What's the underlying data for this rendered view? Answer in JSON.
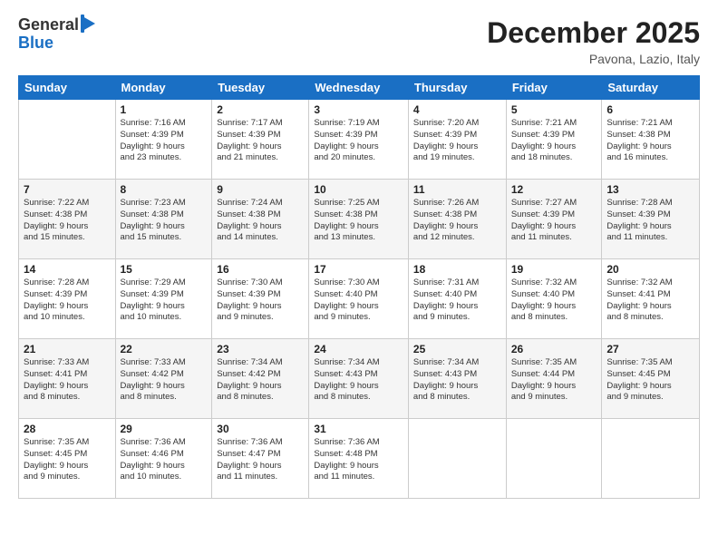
{
  "header": {
    "logo_general": "General",
    "logo_blue": "Blue",
    "title": "December 2025",
    "location": "Pavona, Lazio, Italy"
  },
  "days_of_week": [
    "Sunday",
    "Monday",
    "Tuesday",
    "Wednesday",
    "Thursday",
    "Friday",
    "Saturday"
  ],
  "weeks": [
    [
      {
        "day": "",
        "info": ""
      },
      {
        "day": "1",
        "info": "Sunrise: 7:16 AM\nSunset: 4:39 PM\nDaylight: 9 hours\nand 23 minutes."
      },
      {
        "day": "2",
        "info": "Sunrise: 7:17 AM\nSunset: 4:39 PM\nDaylight: 9 hours\nand 21 minutes."
      },
      {
        "day": "3",
        "info": "Sunrise: 7:19 AM\nSunset: 4:39 PM\nDaylight: 9 hours\nand 20 minutes."
      },
      {
        "day": "4",
        "info": "Sunrise: 7:20 AM\nSunset: 4:39 PM\nDaylight: 9 hours\nand 19 minutes."
      },
      {
        "day": "5",
        "info": "Sunrise: 7:21 AM\nSunset: 4:39 PM\nDaylight: 9 hours\nand 18 minutes."
      },
      {
        "day": "6",
        "info": "Sunrise: 7:21 AM\nSunset: 4:38 PM\nDaylight: 9 hours\nand 16 minutes."
      }
    ],
    [
      {
        "day": "7",
        "info": "Sunrise: 7:22 AM\nSunset: 4:38 PM\nDaylight: 9 hours\nand 15 minutes."
      },
      {
        "day": "8",
        "info": "Sunrise: 7:23 AM\nSunset: 4:38 PM\nDaylight: 9 hours\nand 15 minutes."
      },
      {
        "day": "9",
        "info": "Sunrise: 7:24 AM\nSunset: 4:38 PM\nDaylight: 9 hours\nand 14 minutes."
      },
      {
        "day": "10",
        "info": "Sunrise: 7:25 AM\nSunset: 4:38 PM\nDaylight: 9 hours\nand 13 minutes."
      },
      {
        "day": "11",
        "info": "Sunrise: 7:26 AM\nSunset: 4:38 PM\nDaylight: 9 hours\nand 12 minutes."
      },
      {
        "day": "12",
        "info": "Sunrise: 7:27 AM\nSunset: 4:39 PM\nDaylight: 9 hours\nand 11 minutes."
      },
      {
        "day": "13",
        "info": "Sunrise: 7:28 AM\nSunset: 4:39 PM\nDaylight: 9 hours\nand 11 minutes."
      }
    ],
    [
      {
        "day": "14",
        "info": "Sunrise: 7:28 AM\nSunset: 4:39 PM\nDaylight: 9 hours\nand 10 minutes."
      },
      {
        "day": "15",
        "info": "Sunrise: 7:29 AM\nSunset: 4:39 PM\nDaylight: 9 hours\nand 10 minutes."
      },
      {
        "day": "16",
        "info": "Sunrise: 7:30 AM\nSunset: 4:39 PM\nDaylight: 9 hours\nand 9 minutes."
      },
      {
        "day": "17",
        "info": "Sunrise: 7:30 AM\nSunset: 4:40 PM\nDaylight: 9 hours\nand 9 minutes."
      },
      {
        "day": "18",
        "info": "Sunrise: 7:31 AM\nSunset: 4:40 PM\nDaylight: 9 hours\nand 9 minutes."
      },
      {
        "day": "19",
        "info": "Sunrise: 7:32 AM\nSunset: 4:40 PM\nDaylight: 9 hours\nand 8 minutes."
      },
      {
        "day": "20",
        "info": "Sunrise: 7:32 AM\nSunset: 4:41 PM\nDaylight: 9 hours\nand 8 minutes."
      }
    ],
    [
      {
        "day": "21",
        "info": "Sunrise: 7:33 AM\nSunset: 4:41 PM\nDaylight: 9 hours\nand 8 minutes."
      },
      {
        "day": "22",
        "info": "Sunrise: 7:33 AM\nSunset: 4:42 PM\nDaylight: 9 hours\nand 8 minutes."
      },
      {
        "day": "23",
        "info": "Sunrise: 7:34 AM\nSunset: 4:42 PM\nDaylight: 9 hours\nand 8 minutes."
      },
      {
        "day": "24",
        "info": "Sunrise: 7:34 AM\nSunset: 4:43 PM\nDaylight: 9 hours\nand 8 minutes."
      },
      {
        "day": "25",
        "info": "Sunrise: 7:34 AM\nSunset: 4:43 PM\nDaylight: 9 hours\nand 8 minutes."
      },
      {
        "day": "26",
        "info": "Sunrise: 7:35 AM\nSunset: 4:44 PM\nDaylight: 9 hours\nand 9 minutes."
      },
      {
        "day": "27",
        "info": "Sunrise: 7:35 AM\nSunset: 4:45 PM\nDaylight: 9 hours\nand 9 minutes."
      }
    ],
    [
      {
        "day": "28",
        "info": "Sunrise: 7:35 AM\nSunset: 4:45 PM\nDaylight: 9 hours\nand 9 minutes."
      },
      {
        "day": "29",
        "info": "Sunrise: 7:36 AM\nSunset: 4:46 PM\nDaylight: 9 hours\nand 10 minutes."
      },
      {
        "day": "30",
        "info": "Sunrise: 7:36 AM\nSunset: 4:47 PM\nDaylight: 9 hours\nand 11 minutes."
      },
      {
        "day": "31",
        "info": "Sunrise: 7:36 AM\nSunset: 4:48 PM\nDaylight: 9 hours\nand 11 minutes."
      },
      {
        "day": "",
        "info": ""
      },
      {
        "day": "",
        "info": ""
      },
      {
        "day": "",
        "info": ""
      }
    ]
  ]
}
